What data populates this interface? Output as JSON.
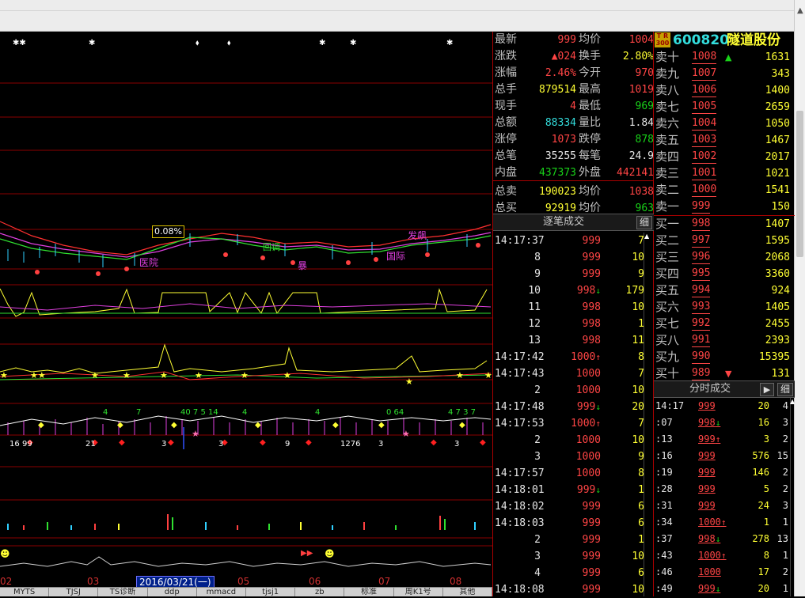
{
  "quote": {
    "rows": [
      {
        "l1": "最新",
        "v1": "999",
        "c1": "red",
        "l2": "均价",
        "v2": "1004",
        "c2": "red"
      },
      {
        "l1": "涨跌",
        "v1": "▲024",
        "c1": "red",
        "l2": "换手",
        "v2": "2.80%",
        "c2": "yel"
      },
      {
        "l1": "涨幅",
        "v1": "2.46%",
        "c1": "red",
        "l2": "今开",
        "v2": "970",
        "c2": "red"
      },
      {
        "l1": "总手",
        "v1": "879514",
        "c1": "yel",
        "l2": "最高",
        "v2": "1019",
        "c2": "red"
      },
      {
        "l1": "现手",
        "v1": "4",
        "c1": "red",
        "l2": "最低",
        "v2": "969",
        "c2": "grn"
      },
      {
        "l1": "总额",
        "v1": "88334",
        "c1": "cyn",
        "l2": "量比",
        "v2": "1.84",
        "c2": "wht"
      },
      {
        "l1": "涨停",
        "v1": "1073",
        "c1": "red",
        "l2": "跌停",
        "v2": "878",
        "c2": "grn"
      },
      {
        "l1": "总笔",
        "v1": "35255",
        "c1": "wht",
        "l2": "每笔",
        "v2": "24.9",
        "c2": "wht"
      },
      {
        "l1": "内盘",
        "v1": "437373",
        "c1": "grn",
        "l2": "外盘",
        "v2": "442141",
        "c2": "red"
      },
      {
        "l1": "总卖",
        "v1": "190023",
        "c1": "yel",
        "l2": "均价",
        "v2": "1038",
        "c2": "red"
      },
      {
        "l1": "总买",
        "v1": "92919",
        "c1": "yel",
        "l2": "均价",
        "v2": "963",
        "c2": "grn"
      }
    ]
  },
  "stock": {
    "badge_top": "T R",
    "badge_bottom": "300",
    "code": "600820",
    "name": "隧道股份"
  },
  "sells": [
    {
      "label": "卖十",
      "price": "1008",
      "arrow": "▲",
      "qty": "1631",
      "color": "red"
    },
    {
      "label": "卖九",
      "price": "1007",
      "arrow": "",
      "qty": "343",
      "color": "red"
    },
    {
      "label": "卖八",
      "price": "1006",
      "arrow": "",
      "qty": "1400",
      "color": "red"
    },
    {
      "label": "卖七",
      "price": "1005",
      "arrow": "",
      "qty": "2659",
      "color": "red"
    },
    {
      "label": "卖六",
      "price": "1004",
      "arrow": "",
      "qty": "1050",
      "color": "red"
    },
    {
      "label": "卖五",
      "price": "1003",
      "arrow": "",
      "qty": "1467",
      "color": "red"
    },
    {
      "label": "卖四",
      "price": "1002",
      "arrow": "",
      "qty": "2017",
      "color": "red"
    },
    {
      "label": "卖三",
      "price": "1001",
      "arrow": "",
      "qty": "1021",
      "color": "red"
    },
    {
      "label": "卖二",
      "price": "1000",
      "arrow": "",
      "qty": "1541",
      "color": "red"
    },
    {
      "label": "卖一",
      "price": "999",
      "arrow": "",
      "qty": "150",
      "color": "red"
    }
  ],
  "buys": [
    {
      "label": "买一",
      "price": "998",
      "arrow": "",
      "qty": "1407",
      "color": "red"
    },
    {
      "label": "买二",
      "price": "997",
      "arrow": "",
      "qty": "1595",
      "color": "red"
    },
    {
      "label": "买三",
      "price": "996",
      "arrow": "",
      "qty": "2068",
      "color": "red"
    },
    {
      "label": "买四",
      "price": "995",
      "arrow": "",
      "qty": "3360",
      "color": "red"
    },
    {
      "label": "买五",
      "price": "994",
      "arrow": "",
      "qty": "924",
      "color": "red"
    },
    {
      "label": "买六",
      "price": "993",
      "arrow": "",
      "qty": "1405",
      "color": "red"
    },
    {
      "label": "买七",
      "price": "992",
      "arrow": "",
      "qty": "2455",
      "color": "red"
    },
    {
      "label": "买八",
      "price": "991",
      "arrow": "",
      "qty": "2393",
      "color": "red"
    },
    {
      "label": "买九",
      "price": "990",
      "arrow": "",
      "qty": "15395",
      "color": "red"
    },
    {
      "label": "买十",
      "price": "989",
      "arrow": "▼",
      "qty": "131",
      "color": "red"
    }
  ],
  "ticks": {
    "title": "逐笔成交",
    "detail": "细",
    "rows": [
      {
        "t": "14:17:37",
        "p": "999",
        "a": "",
        "ac": "",
        "v": "7",
        "c": "red"
      },
      {
        "t": "8",
        "p": "999",
        "a": "",
        "ac": "",
        "v": "10",
        "c": "red"
      },
      {
        "t": "9",
        "p": "999",
        "a": "",
        "ac": "",
        "v": "9",
        "c": "red"
      },
      {
        "t": "10",
        "p": "998",
        "a": "↓",
        "ac": "grn",
        "v": "179",
        "c": "red"
      },
      {
        "t": "11",
        "p": "998",
        "a": "",
        "ac": "",
        "v": "10",
        "c": "red"
      },
      {
        "t": "12",
        "p": "998",
        "a": "",
        "ac": "",
        "v": "1",
        "c": "red"
      },
      {
        "t": "13",
        "p": "998",
        "a": "",
        "ac": "",
        "v": "11",
        "c": "red"
      },
      {
        "t": "14:17:42",
        "p": "1000",
        "a": "↑",
        "ac": "red",
        "v": "8",
        "c": "red"
      },
      {
        "t": "14:17:43",
        "p": "1000",
        "a": "",
        "ac": "",
        "v": "7",
        "c": "red"
      },
      {
        "t": "2",
        "p": "1000",
        "a": "",
        "ac": "",
        "v": "10",
        "c": "red"
      },
      {
        "t": "14:17:48",
        "p": "999",
        "a": "↓",
        "ac": "grn",
        "v": "20",
        "c": "red"
      },
      {
        "t": "14:17:53",
        "p": "1000",
        "a": "↑",
        "ac": "red",
        "v": "7",
        "c": "red"
      },
      {
        "t": "2",
        "p": "1000",
        "a": "",
        "ac": "",
        "v": "10",
        "c": "red"
      },
      {
        "t": "3",
        "p": "1000",
        "a": "",
        "ac": "",
        "v": "9",
        "c": "red"
      },
      {
        "t": "14:17:57",
        "p": "1000",
        "a": "",
        "ac": "",
        "v": "8",
        "c": "red"
      },
      {
        "t": "14:18:01",
        "p": "999",
        "a": "↓",
        "ac": "grn",
        "v": "1",
        "c": "red"
      },
      {
        "t": "14:18:02",
        "p": "999",
        "a": "",
        "ac": "",
        "v": "6",
        "c": "red"
      },
      {
        "t": "14:18:03",
        "p": "999",
        "a": "",
        "ac": "",
        "v": "6",
        "c": "red"
      },
      {
        "t": "2",
        "p": "999",
        "a": "",
        "ac": "",
        "v": "1",
        "c": "red"
      },
      {
        "t": "3",
        "p": "999",
        "a": "",
        "ac": "",
        "v": "10",
        "c": "red"
      },
      {
        "t": "4",
        "p": "999",
        "a": "",
        "ac": "",
        "v": "6",
        "c": "red"
      },
      {
        "t": "14:18:08",
        "p": "999",
        "a": "",
        "ac": "",
        "v": "10",
        "c": "red"
      }
    ]
  },
  "fenshi": {
    "title": "分时成交",
    "play": "▶",
    "detail": "细",
    "rows": [
      {
        "t": "14:17",
        "p": "999",
        "a": "",
        "ac": "",
        "v": "20",
        "n": "4"
      },
      {
        "t": ":07",
        "p": "998",
        "a": "↓",
        "ac": "grn",
        "v": "16",
        "n": "3"
      },
      {
        "t": ":13",
        "p": "999",
        "a": "↑",
        "ac": "red",
        "v": "3",
        "n": "2"
      },
      {
        "t": ":16",
        "p": "999",
        "a": "",
        "ac": "",
        "v": "576",
        "n": "15"
      },
      {
        "t": ":19",
        "p": "999",
        "a": "",
        "ac": "",
        "v": "146",
        "n": "2"
      },
      {
        "t": ":28",
        "p": "999",
        "a": "",
        "ac": "",
        "v": "5",
        "n": "2"
      },
      {
        "t": ":31",
        "p": "999",
        "a": "",
        "ac": "",
        "v": "24",
        "n": "3"
      },
      {
        "t": ":34",
        "p": "1000",
        "a": "↑",
        "ac": "red",
        "v": "1",
        "n": "1"
      },
      {
        "t": ":37",
        "p": "998",
        "a": "↓",
        "ac": "grn",
        "v": "278",
        "n": "13"
      },
      {
        "t": ":43",
        "p": "1000",
        "a": "↑",
        "ac": "red",
        "v": "8",
        "n": "1"
      },
      {
        "t": ":46",
        "p": "1000",
        "a": "",
        "ac": "",
        "v": "17",
        "n": "2"
      },
      {
        "t": ":49",
        "p": "999",
        "a": "↓",
        "ac": "grn",
        "v": "20",
        "n": "1"
      }
    ]
  },
  "chart": {
    "bubble": "0.08%",
    "current_date": "2016/03/21(一)",
    "month_labels": [
      "02",
      "03",
      "05",
      "06",
      "07",
      "08"
    ],
    "tabs": [
      "MYTS",
      "TJSJ",
      "TS诊断",
      "ddp",
      "mmacd",
      "tjsj1",
      "zb",
      "标准",
      "周K1号",
      "其他"
    ]
  },
  "colors": {
    "bg": "#000000",
    "up": "#ff4545",
    "down": "#19d219",
    "yellow": "#ffff33",
    "cyan": "#33dddd",
    "grid": "#aa0000"
  }
}
